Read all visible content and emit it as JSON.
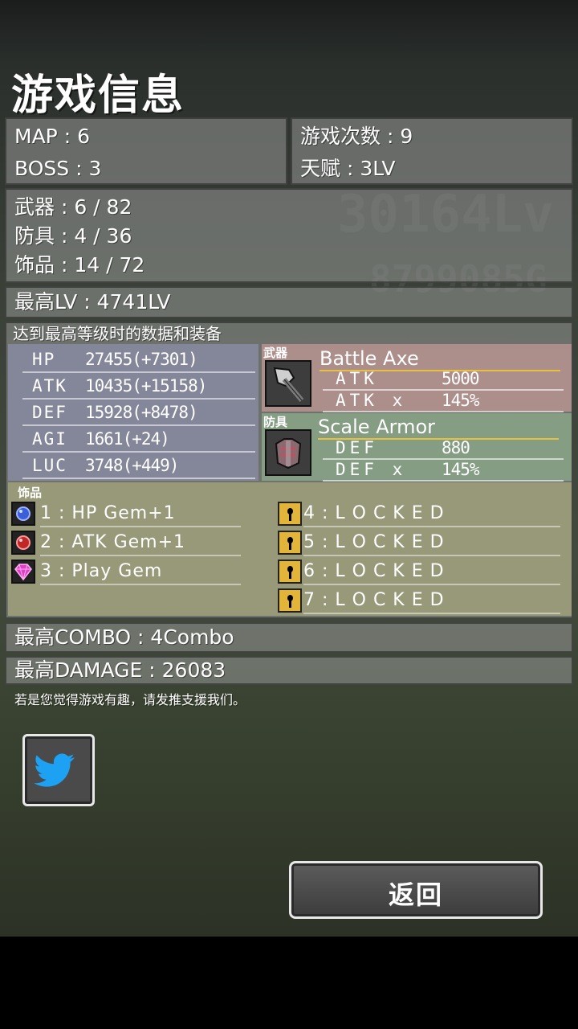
{
  "title": "游戏信息",
  "summary": {
    "map": "MAP : 6",
    "boss": "BOSS : 3",
    "play_count": "游戏次数 : 9",
    "talent": "天赋 : 3LV"
  },
  "collection": {
    "weapon": "武器 : 6 / 82",
    "armor": "防具 : 4 / 36",
    "accessory": "饰品 : 14 / 72"
  },
  "max_lv": "最高LV : 4741LV",
  "record_header": "达到最高等级时的数据和装备",
  "stats": [
    {
      "label": "HP",
      "value": "27455(+7301)"
    },
    {
      "label": "ATK",
      "value": "10435(+15158)"
    },
    {
      "label": "DEF",
      "value": "15928(+8478)"
    },
    {
      "label": "AGI",
      "value": "1661(+24)"
    },
    {
      "label": "LUC",
      "value": "3748(+449)"
    }
  ],
  "weapon": {
    "tag": "武器",
    "name": "Battle Axe",
    "line1": {
      "key": "ATK",
      "value": "5000"
    },
    "line2": {
      "key": "ATK x",
      "value": "145%"
    }
  },
  "armor": {
    "tag": "防具",
    "name": "Scale Armor",
    "line1": {
      "key": "DEF",
      "value": "880"
    },
    "line2": {
      "key": "DEF x",
      "value": "145%"
    }
  },
  "accessories": {
    "tag": "饰品",
    "items": [
      {
        "label": "1 : HP Gem+1",
        "icon": "blue-gem-icon"
      },
      {
        "label": "2 : ATK Gem+1",
        "icon": "red-gem-icon"
      },
      {
        "label": "3 : Play Gem",
        "icon": "pink-diamond-icon"
      },
      {
        "label": "4 : L O C K E D",
        "icon": "lock-icon"
      },
      {
        "label": "5 : L O C K E D",
        "icon": "lock-icon"
      },
      {
        "label": "6 : L O C K E D",
        "icon": "lock-icon"
      },
      {
        "label": "7 : L O C K E D",
        "icon": "lock-icon"
      }
    ]
  },
  "max_combo": "最高COMBO : 4Combo",
  "max_damage": "最高DAMAGE : 26083",
  "support_text": "若是您觉得游戏有趣，请发推支援我们。",
  "back_button": "返回",
  "colors": {
    "weapon_panel": "#b89a98",
    "armor_panel": "#8aa88a",
    "stats_panel": "#8c8ea8",
    "accessory_panel": "#a2a37c",
    "twitter_blue": "#1da1f2"
  }
}
